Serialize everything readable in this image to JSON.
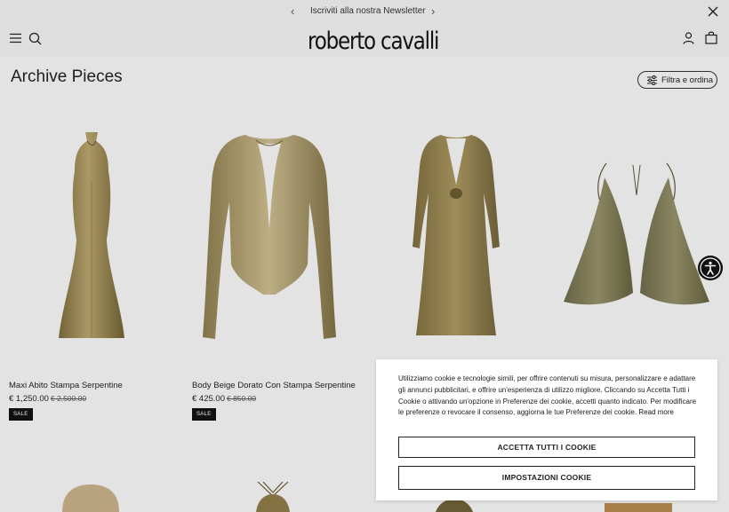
{
  "promo": {
    "text": "Iscriviti alla nostra Newsletter",
    "prev_glyph": "‹",
    "next_glyph": "›"
  },
  "header": {
    "logo": "roberto cavalli"
  },
  "page": {
    "title": "Archive Pieces",
    "filter_label": "Filtra e ordina"
  },
  "products": [
    {
      "name": "Maxi Abito Stampa Serpentine",
      "price": "€ 1,250.00",
      "old_price": "€ 2,500.00",
      "badge": "SALE"
    },
    {
      "name": "Body Beige Dorato Con Stampa Serpentine",
      "price": "€ 425.00",
      "old_price": "€ 850.00",
      "badge": "SALE"
    }
  ],
  "cookie": {
    "message": "Utilizziamo cookie e tecnologie simili, per offrire contenuti su misura, personalizzare e adattare gli annunci pubblicitari, e offrire un'esperienza di utilizzo migliore. Cliccando su Accetta Tutti i Cookie o attivando un'opzione in Preferenze dei cookie, accetti quanto indicato. Per modificare le preferenze o revocare il consenso, aggiorna le tue Preferenze dei cookie.",
    "read_more": "Read more",
    "accept_label": "ACCETTA TUTTI I COOKIE",
    "settings_label": "IMPOSTAZIONI COOKIE"
  },
  "colors": {
    "background": "#f2f2f2",
    "gold": "#a8935a",
    "badge": "#111111"
  },
  "icons": [
    "chevron-left-icon",
    "chevron-right-icon",
    "close-icon",
    "menu-icon",
    "search-icon",
    "account-icon",
    "bag-icon",
    "filter-icon",
    "accessibility-icon"
  ]
}
